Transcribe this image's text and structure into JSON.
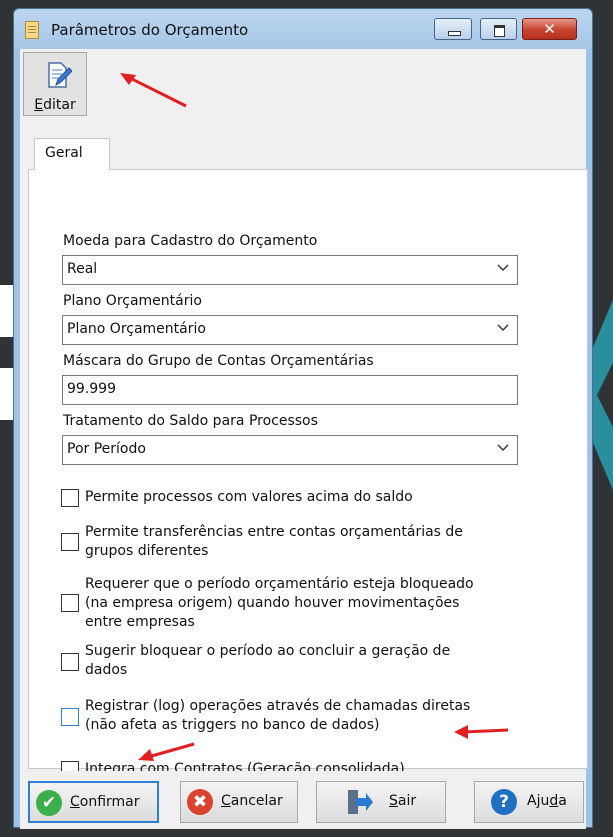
{
  "window": {
    "title": "Parâmetros do Orçamento",
    "close_glyph": "✕"
  },
  "toolbar": {
    "edit_label_accel": "E",
    "edit_label_rest": "ditar"
  },
  "tabs": [
    {
      "label": "Geral"
    }
  ],
  "fields": {
    "moeda": {
      "label": "Moeda para Cadastro do Orçamento",
      "value": "Real"
    },
    "plano": {
      "label": "Plano Orçamentário",
      "value": "Plano Orçamentário"
    },
    "mascara": {
      "label": "Máscara do Grupo de Contas Orçamentárias",
      "value": "99.999"
    },
    "tratamento": {
      "label": "Tratamento do Saldo para Processos",
      "value": "Por Período"
    }
  },
  "checkboxes": [
    {
      "lines": [
        "Permite processos com valores acima do saldo"
      ],
      "checked": false
    },
    {
      "lines": [
        "Permite transferências entre contas orçamentárias de",
        "grupos diferentes"
      ],
      "checked": false
    },
    {
      "lines": [
        "Requerer que o período orçamentário esteja bloqueado",
        "(na empresa origem) quando houver movimentações",
        "entre empresas"
      ],
      "checked": false
    },
    {
      "lines": [
        "Sugerir bloquear o período ao concluir a geração de",
        "dados"
      ],
      "checked": false
    },
    {
      "lines": [
        "Registrar (log) operações através de chamadas diretas",
        "(não afeta as triggers no banco de dados)"
      ],
      "checked": false
    },
    {
      "lines": [
        "Integra com Contratos (Geração consolidada)"
      ],
      "checked": false
    }
  ],
  "buttons": {
    "confirmar": {
      "accel": "C",
      "rest": "onfirmar",
      "icon": "✔"
    },
    "cancelar": {
      "accel": "C",
      "rest": "ancelar",
      "icon": "✖"
    },
    "sair": {
      "accel": "S",
      "rest": "air"
    },
    "ajuda": {
      "pre": "Aju",
      "accel": "d",
      "rest": "a",
      "icon": "?"
    }
  },
  "colors": {
    "annotation_arrow": "#e02020",
    "confirm_green": "#3cae4a",
    "cancel_red": "#d9432f",
    "help_blue": "#1f6fc2"
  }
}
